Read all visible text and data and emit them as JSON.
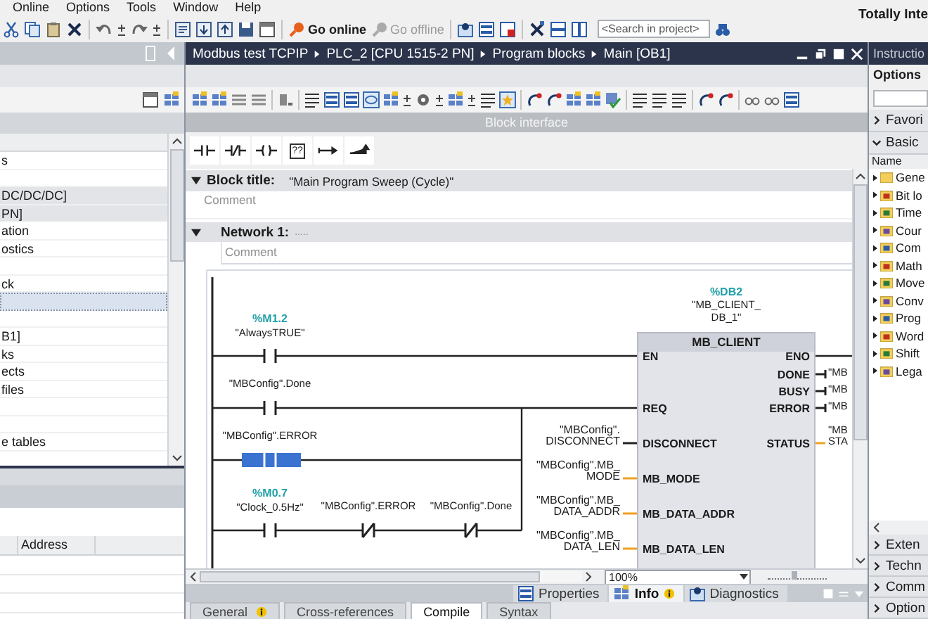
{
  "menu": [
    "Online",
    "Options",
    "Tools",
    "Window",
    "Help"
  ],
  "app_title": "Totally Inte",
  "toolbar": {
    "go_online": "Go online",
    "go_offline": "Go offline",
    "go_offline_disabled": true,
    "search_placeholder": "<Search in project>"
  },
  "project_tree": {
    "rows": [
      {
        "label": "s",
        "shaded": false,
        "selected": false
      },
      {
        "shaded": false,
        "selected": false
      },
      {
        "label": "DC/DC/DC]",
        "shaded": true,
        "selected": false
      },
      {
        "label": "PN]",
        "shaded": true,
        "selected": false
      },
      {
        "label": "ation",
        "shaded": false,
        "selected": false
      },
      {
        "label": "ostics",
        "shaded": false,
        "selected": false
      },
      {
        "shaded": false,
        "selected": false
      },
      {
        "label": "ck",
        "shaded": false,
        "selected": false
      },
      {
        "shaded": false,
        "selected": true
      },
      {
        "shaded": false,
        "selected": false
      },
      {
        "label": "B1]",
        "shaded": false,
        "selected": false
      },
      {
        "label": "ks",
        "shaded": false,
        "selected": false
      },
      {
        "label": "ects",
        "shaded": false,
        "selected": false
      },
      {
        "label": "files",
        "shaded": false,
        "selected": false
      },
      {
        "shaded": false,
        "selected": false
      },
      {
        "shaded": false,
        "selected": false
      },
      {
        "label": "e tables",
        "shaded": false,
        "selected": false
      }
    ]
  },
  "details": {
    "columns": [
      "Address"
    ]
  },
  "editor": {
    "breadcrumb": [
      "Modbus test TCPIP",
      "PLC_2 [CPU 1515-2 PN]",
      "Program blocks",
      "Main [OB1]"
    ],
    "block_interface": "Block interface",
    "instructions": [
      {
        "kind": "contact"
      },
      {
        "kind": "negated"
      },
      {
        "kind": "coil"
      },
      {
        "kind": "box",
        "label": "??"
      },
      {
        "kind": "branch_open"
      },
      {
        "kind": "branch_close"
      }
    ],
    "block_title": {
      "label": "Block title:",
      "value": "\"Main Program Sweep (Cycle)\"",
      "expanded": true,
      "comment": "Comment"
    },
    "network": {
      "label": "Network 1:",
      "title": ".....",
      "expanded": true,
      "comment": "Comment"
    },
    "rungs": [
      {
        "contacts": [
          {
            "kind": "no",
            "address": "%M1.2",
            "tag": "\"AlwaysTRUE\"",
            "selected": false
          }
        ]
      },
      {
        "contacts": [
          {
            "kind": "no",
            "tag": "\"MBConfig\".Done",
            "selected": false
          }
        ]
      },
      {
        "contacts": [
          {
            "kind": "no",
            "tag": "\"MBConfig\".ERROR",
            "selected": true
          }
        ]
      },
      {
        "contacts": [
          {
            "kind": "no",
            "address": "%M0.7",
            "tag": "\"Clock_0.5Hz\"",
            "selected": false
          },
          {
            "kind": "nc",
            "tag": "\"MBConfig\".ERROR",
            "selected": false
          },
          {
            "kind": "nc",
            "tag": "\"MBConfig\".Done",
            "selected": false
          }
        ]
      }
    ],
    "block": {
      "instance_address": "%DB2",
      "instance_name": [
        "\"MB_CLIENT_",
        "DB_1\""
      ],
      "type": "MB_CLIENT",
      "inputs": [
        {
          "name": "EN"
        },
        {
          "name": "REQ"
        },
        {
          "name": "DISCONNECT",
          "kind": "bool",
          "operand": [
            "\"MBConfig\".",
            "DISCONNECT"
          ]
        },
        {
          "name": "MB_MODE",
          "kind": "word",
          "operand": [
            "\"MBConfig\".MB_",
            "MODE"
          ]
        },
        {
          "name": "MB_DATA_ADDR",
          "kind": "word",
          "operand": [
            "\"MBConfig\".MB_",
            "DATA_ADDR"
          ]
        },
        {
          "name": "MB_DATA_LEN",
          "kind": "word",
          "operand": [
            "\"MBConfig\".MB_",
            "DATA_LEN"
          ]
        }
      ],
      "outputs": [
        {
          "name": "ENO"
        },
        {
          "name": "DONE",
          "kind": "bool",
          "operand": [
            "\"MB"
          ]
        },
        {
          "name": "BUSY",
          "kind": "bool",
          "operand": [
            "\"MB"
          ]
        },
        {
          "name": "ERROR",
          "kind": "bool",
          "operand": [
            "\"MB"
          ]
        },
        {
          "name": "STATUS",
          "kind": "word",
          "operand": [
            "\"MB",
            "STA"
          ]
        }
      ]
    },
    "zoom": "100%",
    "zoom_slider": {
      "level": 0.45
    }
  },
  "inspector": {
    "tabs": [
      {
        "label": "Properties",
        "selected": false,
        "info": false
      },
      {
        "label": "Info",
        "selected": true,
        "info": true
      },
      {
        "label": "Diagnostics",
        "selected": false,
        "info": false
      }
    ],
    "subtabs": [
      {
        "label": "General",
        "selected": false,
        "info": true
      },
      {
        "label": "Cross-references",
        "selected": false,
        "info": false
      },
      {
        "label": "Compile",
        "selected": true,
        "info": false
      },
      {
        "label": "Syntax",
        "selected": false,
        "info": false
      }
    ]
  },
  "instructions_panel": {
    "title": "Instructio",
    "options": "Options",
    "sections_top": [
      {
        "label": "Favori",
        "expanded": false
      },
      {
        "label": "Basic",
        "expanded": true
      }
    ],
    "column": "Name",
    "items": [
      "Gene",
      "Bit lo",
      "Time",
      "Cour",
      "Com",
      "Math",
      "Move",
      "Conv",
      "Prog",
      "Word",
      "Shift",
      "Lega"
    ],
    "sections_bottom": [
      {
        "label": "Exten",
        "expanded": false
      },
      {
        "label": "Techn",
        "expanded": false
      },
      {
        "label": "Comm",
        "expanded": false
      },
      {
        "label": "Option",
        "expanded": false
      }
    ]
  }
}
